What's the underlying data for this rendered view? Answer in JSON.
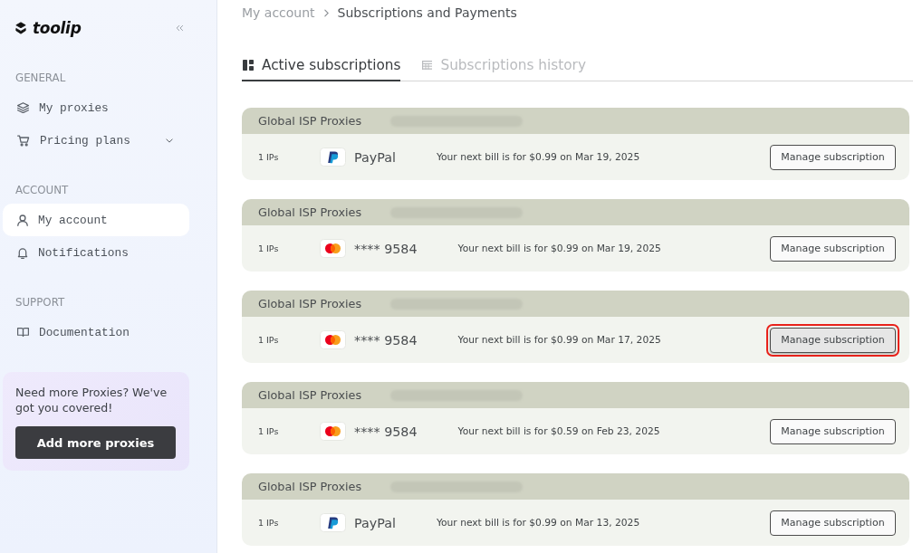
{
  "sidebar": {
    "logo": "toolip",
    "sections": [
      {
        "title": "GENERAL",
        "items": [
          {
            "label": "My proxies",
            "kind": "link",
            "selected": false
          },
          {
            "label": "Pricing plans",
            "kind": "group",
            "expanded": false,
            "selected": false
          }
        ]
      },
      {
        "title": "ACCOUNT",
        "items": [
          {
            "label": "My account",
            "kind": "link",
            "selected": true
          },
          {
            "label": "Notifications",
            "kind": "link",
            "selected": false
          }
        ]
      },
      {
        "title": "SUPPORT",
        "items": [
          {
            "label": "Documentation",
            "kind": "link",
            "selected": false
          }
        ]
      }
    ],
    "promo": {
      "text": "Need more Proxies? We've got you covered!",
      "button": "Add more proxies"
    }
  },
  "breadcrumb": [
    {
      "label": "My account",
      "current": false
    },
    {
      "label": "Subscriptions and Payments",
      "current": true
    }
  ],
  "tabs": [
    {
      "label": "Active subscriptions",
      "selected": true
    },
    {
      "label": "Subscriptions history",
      "selected": false
    }
  ],
  "subscriptions": [
    {
      "plan": "Global ISP Proxies",
      "ips": "1 IPs",
      "payment": {
        "kind": "paypal",
        "label": "PayPal"
      },
      "next_bill": "Your next bill is for $0.99 on Mar 19, 2025",
      "button": "Manage subscription",
      "focused": false
    },
    {
      "plan": "Global ISP Proxies",
      "ips": "1 IPs",
      "payment": {
        "kind": "card",
        "label": "**** 9584"
      },
      "next_bill": "Your next bill is for $0.99 on Mar 19, 2025",
      "button": "Manage subscription",
      "focused": false
    },
    {
      "plan": "Global ISP Proxies",
      "ips": "1 IPs",
      "payment": {
        "kind": "card",
        "label": "**** 9584"
      },
      "next_bill": "Your next bill is for $0.99 on Mar 17, 2025",
      "button": "Manage subscription",
      "focused": true
    },
    {
      "plan": "Global ISP Proxies",
      "ips": "1 IPs",
      "payment": {
        "kind": "card",
        "label": "**** 9584"
      },
      "next_bill": "Your next bill is for $0.59 on Feb 23, 2025",
      "button": "Manage subscription",
      "focused": false
    },
    {
      "plan": "Global ISP Proxies",
      "ips": "1 IPs",
      "payment": {
        "kind": "paypal",
        "label": "PayPal"
      },
      "next_bill": "Your next bill is for $0.99 on Mar 13, 2025",
      "button": "Manage subscription",
      "focused": false
    }
  ]
}
